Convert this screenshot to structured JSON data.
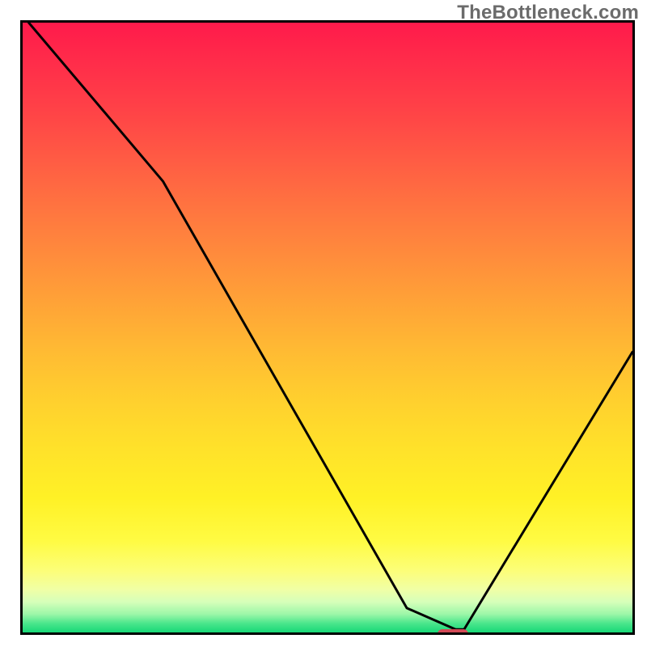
{
  "watermark": "TheBottleneck.com",
  "colors": {
    "border": "#000000",
    "curve": "#000000",
    "marker": "#d24a56",
    "watermark_text": "#6b6b6b"
  },
  "chart_data": {
    "type": "line",
    "title": "",
    "xlabel": "",
    "ylabel": "",
    "xlim": [
      0,
      100
    ],
    "ylim": [
      0,
      100
    ],
    "grid": false,
    "legend": false,
    "background_gradient": {
      "direction": "vertical",
      "stops": [
        {
          "pos": 0.0,
          "color": "#ff1a4b",
          "meaning": "high"
        },
        {
          "pos": 0.5,
          "color": "#ffbb33",
          "meaning": "mid"
        },
        {
          "pos": 0.78,
          "color": "#fff126",
          "meaning": "mid-low"
        },
        {
          "pos": 1.0,
          "color": "#18d877",
          "meaning": "low"
        }
      ]
    },
    "series": [
      {
        "name": "bottleneck-curve",
        "x": [
          1,
          23,
          63,
          71,
          72.4,
          100
        ],
        "values": [
          100,
          74,
          4,
          0.5,
          0.5,
          46
        ],
        "segments_linear": true
      }
    ],
    "marker": {
      "name": "optimal-range",
      "x_range": [
        67.5,
        72.5
      ],
      "y": 0.5,
      "shape": "pill"
    }
  }
}
